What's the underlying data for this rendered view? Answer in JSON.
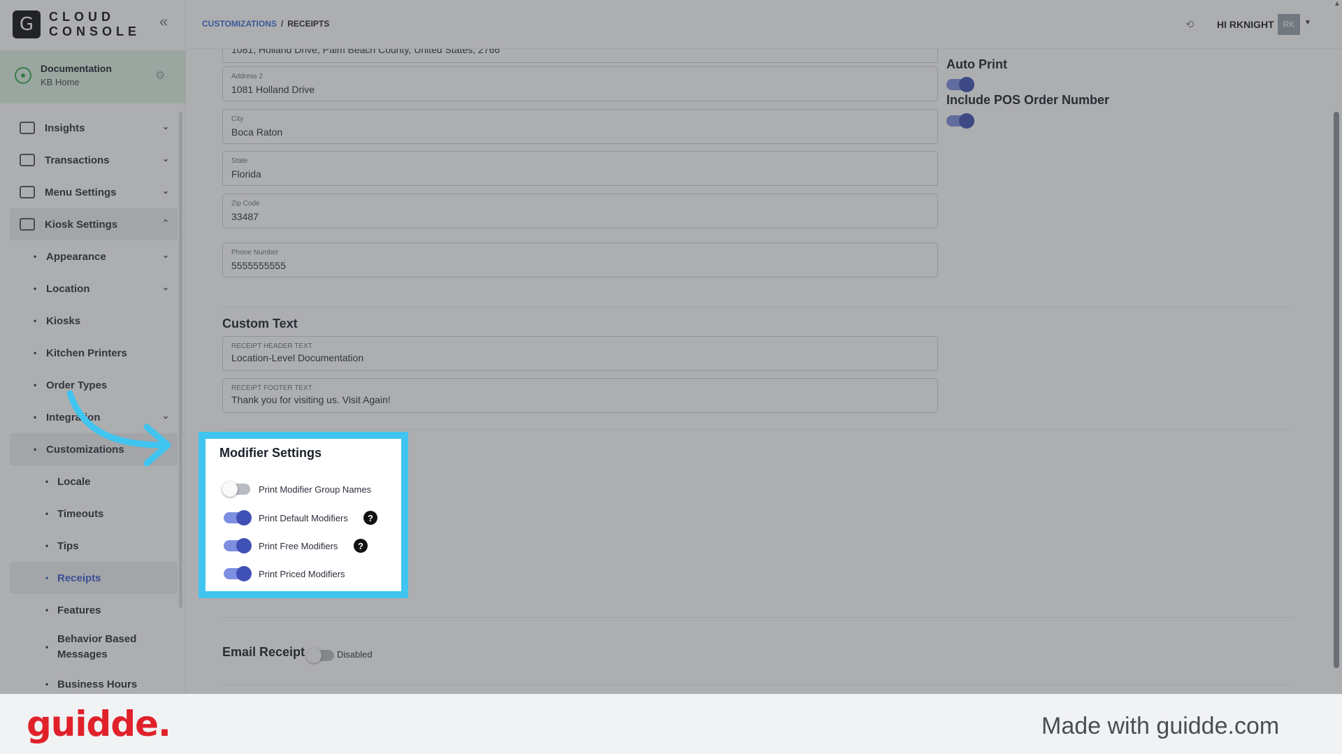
{
  "logo": {
    "letter": "G",
    "line1": "CLOUD",
    "line2": "CONSOLE"
  },
  "org": {
    "name": "Documentation",
    "subtitle": "KB Home"
  },
  "sidebar": {
    "items": [
      {
        "label": "Insights",
        "icon": "chart-icon"
      },
      {
        "label": "Transactions",
        "icon": "receipt-icon"
      },
      {
        "label": "Menu Settings",
        "icon": "menu-icon"
      },
      {
        "label": "Kiosk Settings",
        "icon": "gear-icon"
      }
    ],
    "kiosk_sub": [
      {
        "label": "Appearance"
      },
      {
        "label": "Location"
      },
      {
        "label": "Kiosks"
      },
      {
        "label": "Kitchen Printers"
      },
      {
        "label": "Order Types"
      },
      {
        "label": "Integration"
      },
      {
        "label": "Customizations"
      }
    ],
    "custom_sub": [
      {
        "label": "Locale"
      },
      {
        "label": "Timeouts"
      },
      {
        "label": "Tips"
      },
      {
        "label": "Receipts"
      },
      {
        "label": "Features"
      },
      {
        "label": "Behavior Based Messages"
      },
      {
        "label": "Business Hours"
      }
    ]
  },
  "header": {
    "crumb1": "CUSTOMIZATIONS",
    "sep": "/",
    "crumb2": "RECEIPTS",
    "greeting": "HI RKNIGHT",
    "avatar": "RK"
  },
  "form": {
    "address1_value": "1081, Holland Drive, Palm Beach County, United States, 2766",
    "address2": {
      "label": "Address 2",
      "value": "1081 Holland Drive"
    },
    "city": {
      "label": "City",
      "value": "Boca Raton"
    },
    "state": {
      "label": "State",
      "value": "Florida"
    },
    "zip": {
      "label": "Zip Code",
      "value": "33487"
    },
    "phone": {
      "label": "Phone Number",
      "value": "5555555555"
    }
  },
  "right": {
    "auto_print": "Auto Print",
    "include_pos": "Include POS Order Number"
  },
  "custom_text": {
    "title": "Custom Text",
    "header": {
      "label": "RECEIPT HEADER TEXT",
      "value": "Location-Level Documentation"
    },
    "footer": {
      "label": "RECEIPT FOOTER TEXT",
      "value": "Thank you for visiting us. Visit Again!"
    }
  },
  "modifier": {
    "title": "Modifier Settings",
    "rows": [
      {
        "label": "Print Modifier Group Names",
        "on": false
      },
      {
        "label": "Print Default Modifiers",
        "on": true
      },
      {
        "label": "Print Free Modifiers",
        "on": true
      },
      {
        "label": "Print Priced Modifiers",
        "on": true
      }
    ],
    "help": "?"
  },
  "email": {
    "title": "Email Receipt",
    "status": "Disabled"
  },
  "footer": {
    "brand": "guidde.",
    "made": "Made with guidde.com"
  },
  "colors": {
    "highlight": "#40c4f0",
    "toggle_on": "#3f51b5",
    "brand": "#e0212a",
    "link": "#3a6fd6"
  }
}
